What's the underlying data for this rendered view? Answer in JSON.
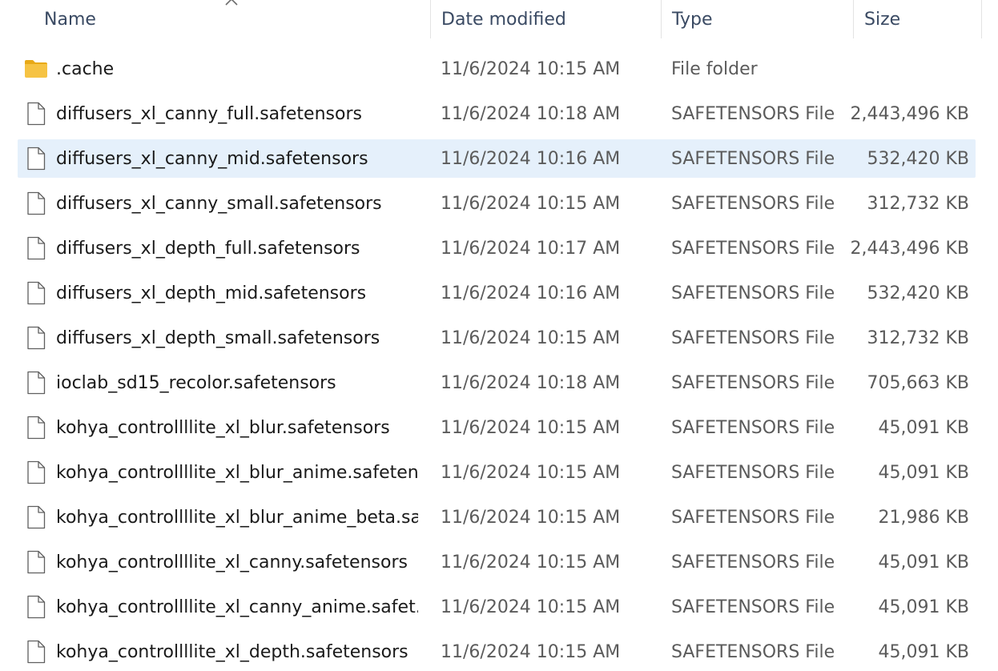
{
  "columns": {
    "name": "Name",
    "date_modified": "Date modified",
    "type": "Type",
    "size": "Size"
  },
  "sort": {
    "column": "name",
    "icon": "chevron-up-icon"
  },
  "selected_row_index": 2,
  "files": [
    {
      "icon": "folder-icon",
      "name": ".cache",
      "date": "11/6/2024 10:15 AM",
      "type": "File folder",
      "size": ""
    },
    {
      "icon": "file-icon",
      "name": "diffusers_xl_canny_full.safetensors",
      "date": "11/6/2024 10:18 AM",
      "type": "SAFETENSORS File",
      "size": "2,443,496 KB"
    },
    {
      "icon": "file-icon",
      "name": "diffusers_xl_canny_mid.safetensors",
      "date": "11/6/2024 10:16 AM",
      "type": "SAFETENSORS File",
      "size": "532,420 KB"
    },
    {
      "icon": "file-icon",
      "name": "diffusers_xl_canny_small.safetensors",
      "date": "11/6/2024 10:15 AM",
      "type": "SAFETENSORS File",
      "size": "312,732 KB"
    },
    {
      "icon": "file-icon",
      "name": "diffusers_xl_depth_full.safetensors",
      "date": "11/6/2024 10:17 AM",
      "type": "SAFETENSORS File",
      "size": "2,443,496 KB"
    },
    {
      "icon": "file-icon",
      "name": "diffusers_xl_depth_mid.safetensors",
      "date": "11/6/2024 10:16 AM",
      "type": "SAFETENSORS File",
      "size": "532,420 KB"
    },
    {
      "icon": "file-icon",
      "name": "diffusers_xl_depth_small.safetensors",
      "date": "11/6/2024 10:15 AM",
      "type": "SAFETENSORS File",
      "size": "312,732 KB"
    },
    {
      "icon": "file-icon",
      "name": "ioclab_sd15_recolor.safetensors",
      "date": "11/6/2024 10:18 AM",
      "type": "SAFETENSORS File",
      "size": "705,663 KB"
    },
    {
      "icon": "file-icon",
      "name": "kohya_controllllite_xl_blur.safetensors",
      "date": "11/6/2024 10:15 AM",
      "type": "SAFETENSORS File",
      "size": "45,091 KB"
    },
    {
      "icon": "file-icon",
      "name": "kohya_controllllite_xl_blur_anime.safeten...",
      "date": "11/6/2024 10:15 AM",
      "type": "SAFETENSORS File",
      "size": "45,091 KB"
    },
    {
      "icon": "file-icon",
      "name": "kohya_controllllite_xl_blur_anime_beta.sa...",
      "date": "11/6/2024 10:15 AM",
      "type": "SAFETENSORS File",
      "size": "21,986 KB"
    },
    {
      "icon": "file-icon",
      "name": "kohya_controllllite_xl_canny.safetensors",
      "date": "11/6/2024 10:15 AM",
      "type": "SAFETENSORS File",
      "size": "45,091 KB"
    },
    {
      "icon": "file-icon",
      "name": "kohya_controllllite_xl_canny_anime.safet...",
      "date": "11/6/2024 10:15 AM",
      "type": "SAFETENSORS File",
      "size": "45,091 KB"
    },
    {
      "icon": "file-icon",
      "name": "kohya_controllllite_xl_depth.safetensors",
      "date": "11/6/2024 10:15 AM",
      "type": "SAFETENSORS File",
      "size": "45,091 KB"
    }
  ],
  "colors": {
    "selected_row_bg": "#e5f0fb",
    "folder_fill": "#f6c343",
    "folder_tab": "#e8a917"
  }
}
